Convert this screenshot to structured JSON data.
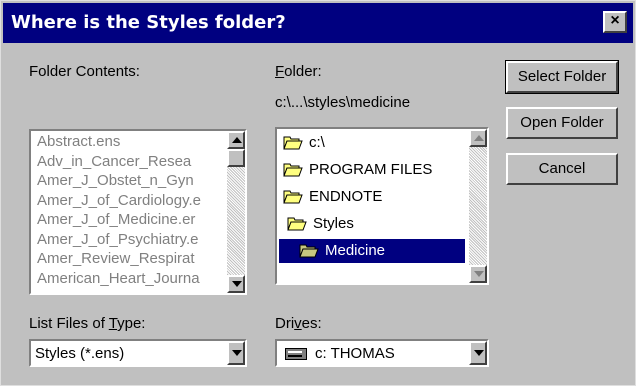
{
  "window": {
    "title": "Where is the Styles folder?",
    "close_glyph": "×"
  },
  "folder_contents": {
    "label": "Folder Contents:",
    "items": [
      "Abstract.ens",
      "Adv_in_Cancer_Resea",
      "Amer_J_Obstet_n_Gyn",
      "Amer_J_of_Cardiology.e",
      "Amer_J_of_Medicine.er",
      "Amer_J_of_Psychiatry.e",
      "Amer_Review_Respirat",
      "American_Heart_Journa"
    ]
  },
  "folder": {
    "label_prefix": "",
    "label_accel": "F",
    "label_rest": "older:",
    "path": "c:\\...\\styles\\medicine",
    "tree": [
      {
        "name": "c:\\",
        "icon": "open-folder-icon",
        "selected": false
      },
      {
        "name": "PROGRAM FILES",
        "icon": "open-folder-icon",
        "selected": false
      },
      {
        "name": "ENDNOTE",
        "icon": "open-folder-icon",
        "selected": false
      },
      {
        "name": "Styles",
        "icon": "open-folder-icon",
        "selected": false
      },
      {
        "name": "Medicine",
        "icon": "open-folder-icon",
        "selected": true
      }
    ]
  },
  "file_type": {
    "label_prefix": "List Files of ",
    "label_accel": "T",
    "label_rest": "ype:",
    "value": "Styles (*.ens)"
  },
  "drives": {
    "label_prefix": "Dri",
    "label_accel": "v",
    "label_rest": "es:",
    "value": "c: THOMAS",
    "icon": "drive-icon"
  },
  "buttons": {
    "select_folder": "Select Folder",
    "open_folder": "Open Folder",
    "cancel": "Cancel"
  },
  "colors": {
    "titlebar": "#000080",
    "face": "#c0c0c0",
    "selection": "#000080"
  }
}
